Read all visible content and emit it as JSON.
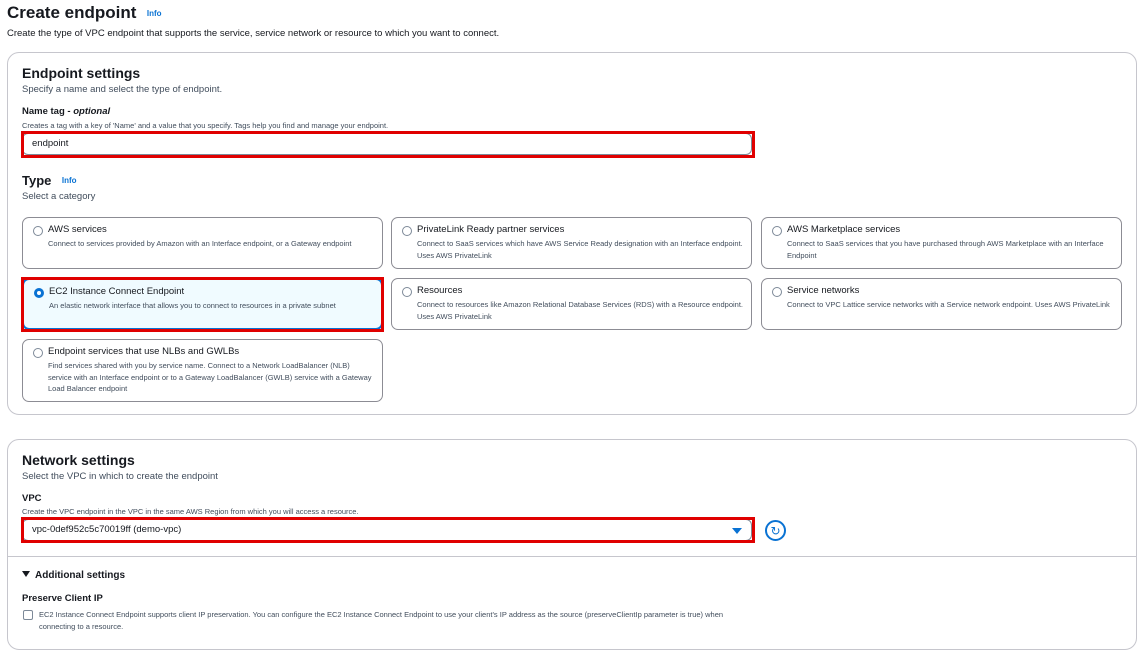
{
  "page": {
    "title": "Create endpoint",
    "info": "Info",
    "description": "Create the type of VPC endpoint that supports the service, service network or resource to which you want to connect."
  },
  "endpoint_settings": {
    "heading": "Endpoint settings",
    "description": "Specify a name and select the type of endpoint.",
    "name_tag": {
      "label": "Name tag - ",
      "optional": "optional",
      "help": "Creates a tag with a key of 'Name' and a value that you specify. Tags help you find and manage your endpoint.",
      "value": "endpoint"
    },
    "type": {
      "label": "Type",
      "info": "Info",
      "description": "Select a category",
      "options": [
        {
          "title": "AWS services",
          "desc": "Connect to services provided by Amazon with an Interface endpoint, or a Gateway endpoint",
          "selected": false
        },
        {
          "title": "PrivateLink Ready partner services",
          "desc": "Connect to SaaS services which have AWS Service Ready designation with an Interface endpoint. Uses AWS PrivateLink",
          "selected": false
        },
        {
          "title": "AWS Marketplace services",
          "desc": "Connect to SaaS services that you have purchased through AWS Marketplace with an Interface Endpoint",
          "selected": false
        },
        {
          "title": "EC2 Instance Connect Endpoint",
          "desc": "An elastic network interface that allows you to connect to resources in a private subnet",
          "selected": true
        },
        {
          "title": "Resources",
          "desc": "Connect to resources like Amazon Relational Database Services (RDS) with a Resource endpoint. Uses AWS PrivateLink",
          "selected": false
        },
        {
          "title": "Service networks",
          "desc": "Connect to VPC Lattice service networks with a Service network endpoint. Uses AWS PrivateLink",
          "selected": false
        },
        {
          "title": "Endpoint services that use NLBs and GWLBs",
          "desc": "Find services shared with you by service name. Connect to a Network LoadBalancer (NLB) service with an Interface endpoint or to a Gateway LoadBalancer (GWLB) service with a Gateway Load Balancer endpoint",
          "selected": false
        }
      ]
    }
  },
  "network_settings": {
    "heading": "Network settings",
    "description": "Select the VPC in which to create the endpoint",
    "vpc": {
      "label": "VPC",
      "help": "Create the VPC endpoint in the VPC in the same AWS Region from which you will access a resource.",
      "value": "vpc-0def952c5c70019ff (demo-vpc)"
    },
    "additional": {
      "label": "Additional settings",
      "preserve_label": "Preserve Client IP",
      "preserve_desc": "EC2 Instance Connect Endpoint supports client IP preservation. You can configure the EC2 Instance Connect Endpoint to use your client's IP address as the source (preserveClientIp parameter is true) when connecting to a resource.",
      "checked": false
    }
  },
  "colors": {
    "accent": "#0972d3",
    "highlight": "#e00000",
    "selected_bg": "#f0fbff"
  }
}
